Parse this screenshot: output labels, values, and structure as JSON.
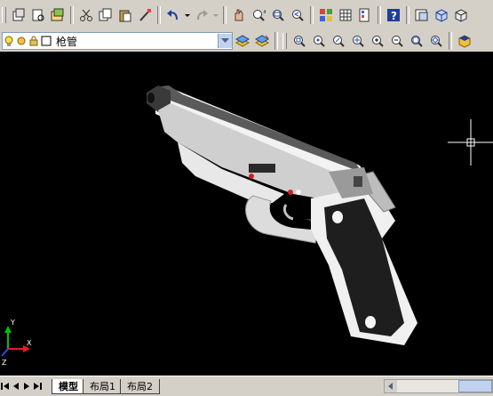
{
  "toolbar_row1": {
    "icons": [
      "copy-to-clipboard-icon",
      "plot-preview-icon",
      "publish-icon",
      "cut-icon",
      "copy-icon",
      "paste-icon",
      "match-properties-icon",
      "undo-icon",
      "undo-dropdown-icon",
      "redo-icon",
      "redo-dropdown-icon",
      "pan-realtime-icon",
      "zoom-realtime-icon",
      "zoom-window-icon",
      "zoom-previous-icon",
      "properties-icon",
      "design-center-icon",
      "tool-palettes-icon",
      "help-icon",
      "named-views-icon",
      "3d-orbit-icon",
      "ucs-icon"
    ]
  },
  "toolbar_row2": {
    "layer_combo": {
      "value": "枪管"
    },
    "icons": [
      "make-layer-current-icon",
      "layer-previous-icon",
      "zoom-window-icon",
      "zoom-dynamic-icon",
      "zoom-scale-icon",
      "zoom-center-icon",
      "zoom-in-icon",
      "zoom-out-icon",
      "zoom-all-icon",
      "zoom-extents-icon",
      "3d-view-icon"
    ]
  },
  "tabs": {
    "model": "模型",
    "layout1": "布局1",
    "layout2": "布局2"
  },
  "ucs": {
    "x": "X",
    "y": "Y",
    "z": "Z"
  },
  "colors": {
    "canvas_bg": "#000000",
    "ui_bg": "#d4d0c8",
    "combo_border": "#7f9db9"
  }
}
